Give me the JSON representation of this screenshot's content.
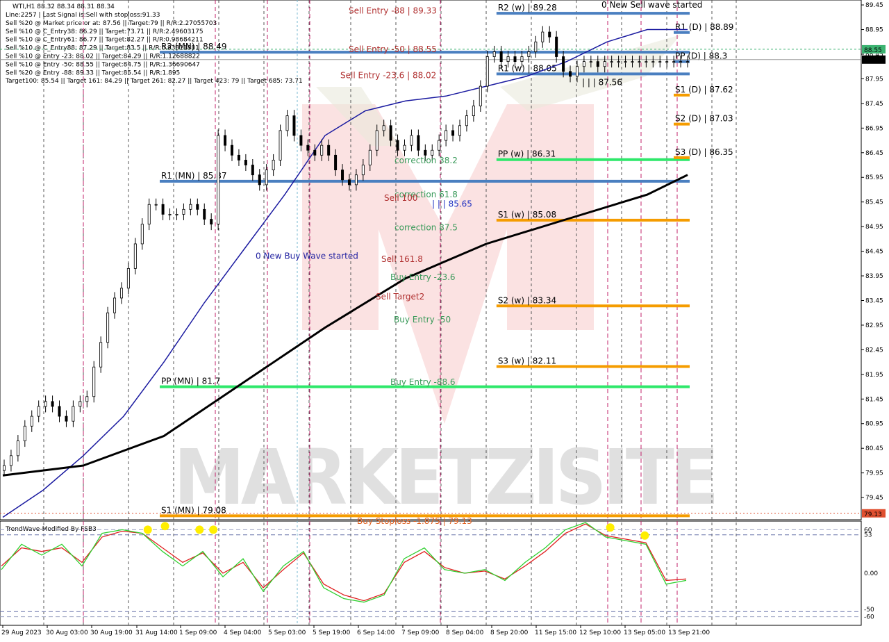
{
  "chart_data": {
    "type": "candlestick",
    "symbol_header": "WTI,H1  88.32 88.34 88.31 88.34",
    "info_lines": [
      "Line:2257 | Last Signal is:Sell with stoploss:91.33",
      "Sell %20 @ Market price or at: 87.56 || Target:79 || R/R:2.27055703",
      "Sell %10 @ C_Entry38: 86.29 || Target:73.71 || R/R:2.49603175",
      "Sell %10 @ C_Entry61: 86.77 || Target:82.27 || R/R:0.98684211",
      "Sell %10 @ C_Entry88: 87.29 || Target:83.5 || R/R:0.93811881",
      "Sell %10 @ Entry -23: 88.02 || Target:84.29 || R/R:1.12688822",
      "Sell %10 @ Entry -50: 88.55 || Target:84.75 || R/R:1.36690647",
      "Sell %20 @ Entry -88: 89.33 || Target:85.54 || R/R:1.895",
      "Target100: 85.54 || Target 161: 84.29 || Target 261: 82.27 || Target 423: 79 || Target 685: 73.71"
    ],
    "y_ticks": [
      "89.45",
      "88.95",
      "88.45",
      "87.95",
      "87.45",
      "86.95",
      "86.45",
      "85.95",
      "85.45",
      "84.95",
      "84.45",
      "83.95",
      "83.45",
      "82.95",
      "82.45",
      "81.95",
      "81.45",
      "80.95",
      "80.45",
      "79.95",
      "79.45"
    ],
    "ylim": [
      79.0,
      89.55
    ],
    "x_ticks": [
      "29 Aug 2023",
      "30 Aug 03:00",
      "30 Aug 19:00",
      "31 Aug 14:00",
      "1 Sep 09:00",
      "4 Sep 04:00",
      "5 Sep 03:00",
      "5 Sep 19:00",
      "6 Sep 14:00",
      "7 Sep 09:00",
      "8 Sep 04:00",
      "8 Sep 20:00",
      "11 Sep 15:00",
      "12 Sep 10:00",
      "13 Sep 05:00",
      "13 Sep 21:00"
    ],
    "price_tags": [
      {
        "value": 88.34,
        "label": "88.34",
        "bg": "#000000",
        "fg": "#ffffff"
      },
      {
        "value": 88.55,
        "label": "88.55",
        "bg": "#3cb371",
        "fg": "#ffffff"
      },
      {
        "value": 79.13,
        "label": "79.13",
        "bg": "#e05030",
        "fg": "#ffffff"
      }
    ],
    "levels": [
      {
        "label": "R2 (w) | 89.28",
        "value": 89.28,
        "color": "#4a7fc0",
        "x0": 0.56
      },
      {
        "label": "R1 (D) | 88.89",
        "value": 88.89,
        "color": "#4a7fc0",
        "x0": 0.76
      },
      {
        "label": "R2 (MN) | 88.49",
        "value": 88.49,
        "color": "#4a7fc0",
        "x0": 0.18
      },
      {
        "label": "PP (D) | 88.3",
        "value": 88.3,
        "color": "#4a7fc0",
        "x0": 0.76
      },
      {
        "label": "R1 (w) | 88.05",
        "value": 88.05,
        "color": "#4a7fc0",
        "x0": 0.56
      },
      {
        "label": "S1 (D) | 87.62",
        "value": 87.62,
        "color": "#f59c00",
        "x0": 0.76
      },
      {
        "label": "S2 (D) | 87.03",
        "value": 87.03,
        "color": "#f59c00",
        "x0": 0.76
      },
      {
        "label": "PP (w) | 86.31",
        "value": 86.31,
        "color": "#2ee86a",
        "x0": 0.56
      },
      {
        "label": "S3 (D) | 86.35",
        "value": 86.35,
        "color": "#f59c00",
        "x0": 0.76
      },
      {
        "label": "R1 (MN) | 85.87",
        "value": 85.87,
        "color": "#4a7fc0",
        "x0": 0.18
      },
      {
        "label": "S1 (w) | 85.08",
        "value": 85.08,
        "color": "#f59c00",
        "x0": 0.56
      },
      {
        "label": "S2 (w) | 83.34",
        "value": 83.34,
        "color": "#f59c00",
        "x0": 0.56
      },
      {
        "label": "S3 (w) | 82.11",
        "value": 82.11,
        "color": "#f59c00",
        "x0": 0.56
      },
      {
        "label": "PP (MN) | 81.7",
        "value": 81.7,
        "color": "#2ee86a",
        "x0": 0.18
      },
      {
        "label": "S1 (MN) | 79.08",
        "value": 79.08,
        "color": "#f59c00",
        "x0": 0.18
      }
    ],
    "annotations": [
      {
        "text": "Sell Entry -88 | 89.33",
        "value": 89.33,
        "color": "#b03030"
      },
      {
        "text": "Sell Entry -50 | 88.55",
        "value": 88.55,
        "color": "#b03030"
      },
      {
        "text": "Sell Entry -23.6 | 88.02",
        "value": 88.02,
        "color": "#b03030"
      },
      {
        "text": "correction 38.2",
        "value": 86.29,
        "color": "#3a9a5a"
      },
      {
        "text": "correction 61.8",
        "value": 85.6,
        "color": "#3a9a5a"
      },
      {
        "text": "Sell 100",
        "value": 85.53,
        "color": "#b03030"
      },
      {
        "text": "| | | 85.65",
        "value": 85.41,
        "color": "#2030c0"
      },
      {
        "text": "correction 87.5",
        "value": 84.93,
        "color": "#3a9a5a"
      },
      {
        "text": "Sell 161.8",
        "value": 84.29,
        "color": "#b03030"
      },
      {
        "text": "Buy Entry -23.6",
        "value": 83.92,
        "color": "#3a9a5a"
      },
      {
        "text": "Sell Target2",
        "value": 83.53,
        "color": "#b03030"
      },
      {
        "text": "Buy Entry -50",
        "value": 83.06,
        "color": "#3a9a5a"
      },
      {
        "text": "Buy Entry -88.6",
        "value": 81.79,
        "color": "#3a9a5a"
      },
      {
        "text": "Buy Stoploss -1.875 | 79.13",
        "value": 78.97,
        "color": "#e06020"
      },
      {
        "text": "0 New Sell wave started",
        "value": 89.45,
        "color": "#000000"
      },
      {
        "text": "0 New Buy Wave started",
        "value": 84.35,
        "color": "#2020a0"
      },
      {
        "text": "| | | 87.56",
        "value": 87.88,
        "color": "#000000"
      }
    ],
    "series": [
      {
        "name": "price",
        "x": [
          0,
          2,
          4,
          6,
          8,
          10,
          12,
          14,
          16,
          18,
          20,
          22,
          24,
          26,
          28,
          30,
          32,
          34,
          36,
          38,
          40,
          42,
          44,
          46,
          48,
          50,
          52,
          54,
          56,
          58,
          60,
          62,
          64,
          66,
          68,
          70,
          72,
          74,
          76,
          78,
          80,
          82,
          84,
          86,
          88,
          90,
          92,
          94,
          96,
          98,
          100,
          102,
          104,
          106,
          108,
          110,
          112,
          114,
          116,
          118,
          120,
          122,
          124,
          126,
          128,
          130,
          132,
          134,
          136,
          138,
          140,
          142,
          144,
          146,
          148,
          150,
          152,
          154,
          156,
          158,
          160,
          162,
          164,
          166,
          168,
          170,
          172,
          174,
          176,
          178,
          180,
          182,
          184,
          186,
          188,
          190,
          192,
          194,
          196,
          198
        ],
        "y": [
          80.1,
          80.3,
          80.6,
          80.9,
          81.1,
          81.3,
          81.4,
          81.3,
          81.1,
          81.0,
          81.3,
          81.4,
          81.5,
          82.1,
          82.6,
          83.2,
          83.5,
          83.7,
          84.1,
          84.6,
          85.0,
          85.4,
          85.4,
          85.2,
          85.2,
          85.2,
          85.3,
          85.4,
          85.3,
          85.1,
          85.0,
          86.8,
          86.6,
          86.4,
          86.3,
          86.2,
          86.0,
          85.8,
          86.1,
          86.3,
          86.9,
          87.2,
          86.8,
          86.6,
          86.5,
          86.4,
          86.6,
          86.4,
          86.1,
          85.9,
          85.8,
          86.0,
          86.2,
          86.5,
          86.9,
          87.0,
          86.7,
          86.5,
          86.6,
          86.8,
          86.5,
          86.4,
          86.5,
          86.7,
          86.9,
          86.8,
          87.0,
          87.2,
          87.4,
          87.8,
          88.4,
          88.5,
          88.3,
          88.4,
          88.3,
          88.4,
          88.5,
          88.7,
          88.9,
          88.8,
          88.4,
          88.1,
          88.0,
          88.2,
          88.3,
          88.3,
          88.2,
          88.3,
          88.3,
          88.3,
          88.3,
          88.3,
          88.3,
          88.3,
          88.3,
          88.3,
          88.3,
          88.3,
          88.3,
          88.3
        ]
      },
      {
        "name": "MA fast",
        "x": [
          0,
          10,
          20,
          30,
          40,
          50,
          60,
          70,
          80,
          90,
          100,
          110,
          120,
          130,
          140,
          150,
          160,
          170
        ],
        "y": [
          79.05,
          79.6,
          80.3,
          81.1,
          82.2,
          83.4,
          84.5,
          85.6,
          86.8,
          87.3,
          87.5,
          87.6,
          87.8,
          88.0,
          88.3,
          88.7,
          88.95,
          88.95
        ]
      },
      {
        "name": "MA slow",
        "x": [
          0,
          20,
          40,
          60,
          80,
          100,
          120,
          140,
          160,
          170
        ],
        "y": [
          79.9,
          80.1,
          80.7,
          81.8,
          82.9,
          83.9,
          84.6,
          85.1,
          85.6,
          86.0
        ]
      }
    ],
    "oscillator": {
      "title": "TrendWave-Modified By FSB3",
      "y_ticks": [
        "60",
        "53",
        "0.00",
        "-50",
        "-60"
      ],
      "ylim": [
        -70,
        70
      ],
      "x": [
        0,
        5,
        10,
        15,
        20,
        25,
        30,
        35,
        40,
        45,
        50,
        55,
        60,
        65,
        70,
        75,
        80,
        85,
        90,
        95,
        100,
        105,
        110,
        115,
        120,
        125,
        130,
        135,
        140,
        145,
        150,
        155,
        160,
        165,
        170
      ],
      "green": [
        5,
        40,
        25,
        40,
        10,
        55,
        60,
        55,
        30,
        10,
        30,
        -5,
        20,
        -25,
        10,
        30,
        -20,
        -35,
        -40,
        -30,
        20,
        35,
        5,
        0,
        5,
        -10,
        15,
        35,
        60,
        70,
        50,
        45,
        40,
        -15,
        -10
      ],
      "red": [
        10,
        35,
        30,
        35,
        15,
        50,
        58,
        55,
        35,
        15,
        28,
        0,
        15,
        -20,
        5,
        28,
        -15,
        -30,
        -38,
        -28,
        15,
        30,
        8,
        0,
        3,
        -8,
        10,
        30,
        55,
        68,
        52,
        47,
        42,
        -10,
        -8
      ],
      "dots": [
        {
          "x": 42,
          "y": 60
        },
        {
          "x": 47,
          "y": 65
        },
        {
          "x": 57,
          "y": 60
        },
        {
          "x": 61,
          "y": 60
        },
        {
          "x": 176,
          "y": 63
        },
        {
          "x": 186,
          "y": 52
        }
      ]
    },
    "watermark": "MARKETZISITE"
  },
  "colors": {
    "bull": "#1a7a2a",
    "bear": "#111111",
    "ma_fast": "#1a1aa0",
    "ma_slow": "#000000",
    "grid": "#555555",
    "magenta": "#c0206a"
  }
}
